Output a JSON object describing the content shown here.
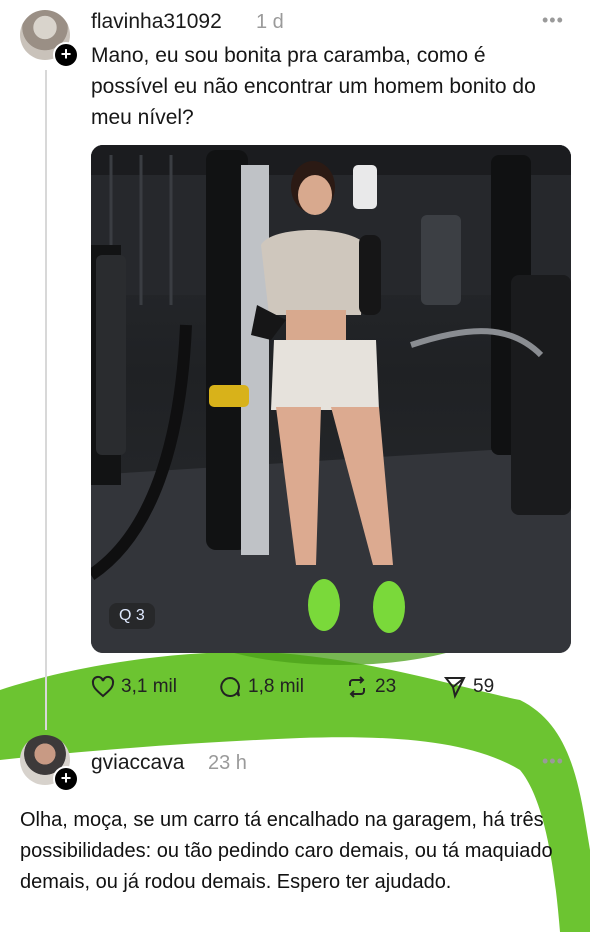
{
  "post": {
    "username": "flavinha31092",
    "time": "1 d",
    "more": "•••",
    "text": "Mano, eu sou bonita pra caramba, como é possível eu não encontrar um homem bonito do meu nível?",
    "photo_badge": "Q 3",
    "actions": {
      "likes": "3,1 mil",
      "comments": "1,8 mil",
      "reposts": "23",
      "shares": "59"
    }
  },
  "reply": {
    "username": "gviaccava",
    "time": "23 h",
    "more": "•••",
    "text": "Olha, moça, se um carro tá encalhado na garagem, há três possibilidades: ou tão pedindo caro demais, ou tá maquiado demais, ou já rodou demais. Espero ter ajudado."
  },
  "icons": {
    "like": "heart-icon",
    "comment": "comment-icon",
    "repost": "repost-icon",
    "share": "send-icon",
    "follow": "plus-icon",
    "more": "more-icon"
  },
  "colors": {
    "highlight_green": "#5fbf1f",
    "text": "#161616",
    "muted": "#9a9a9a"
  }
}
